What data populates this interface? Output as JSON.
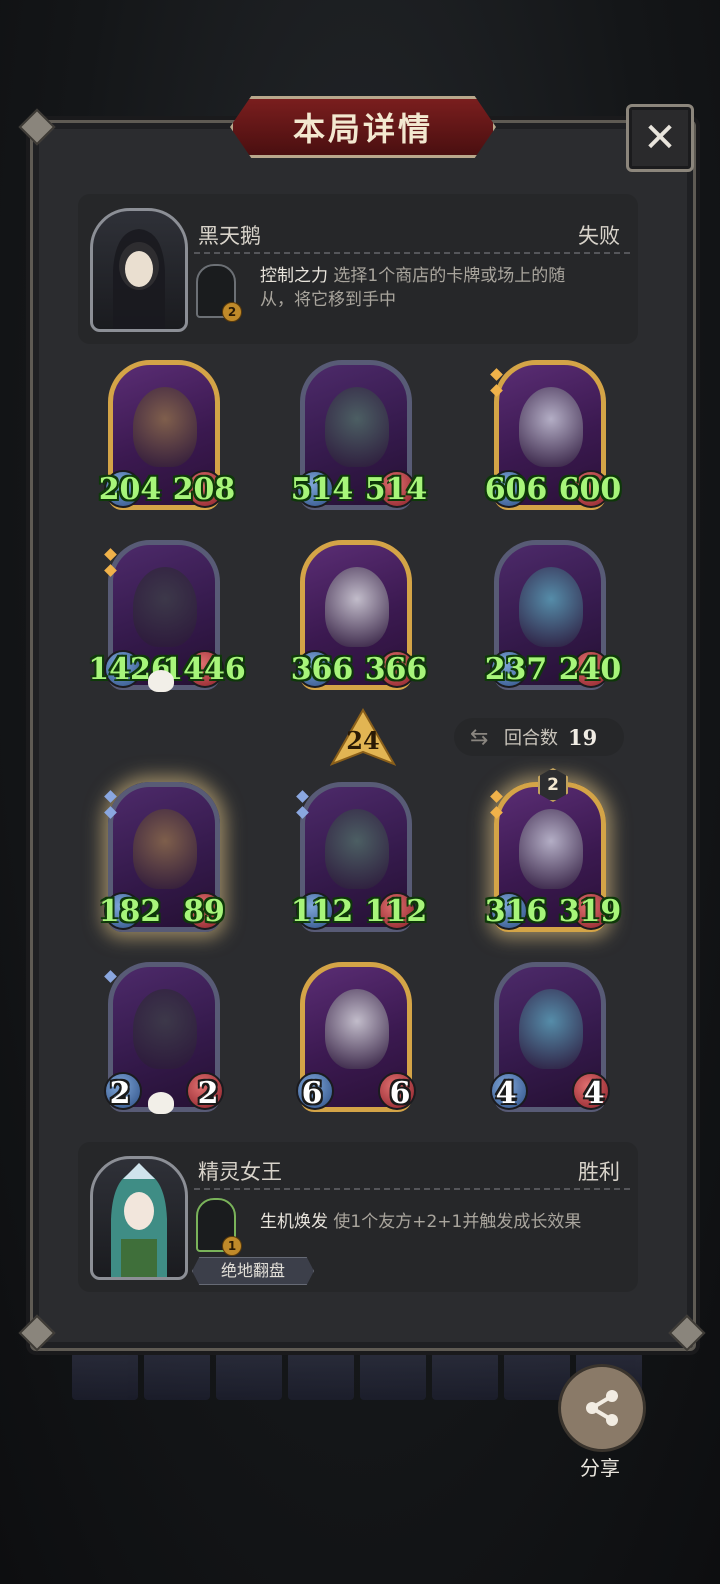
{
  "title": "本局详情",
  "close_symbol": "✕",
  "opponent": {
    "name": "黑天鹅",
    "result": "失败",
    "hero_power_level": "2",
    "ability_name": "控制之力",
    "ability_text_1": "选择1个商店的卡牌或场上的随",
    "ability_text_2": "从，将它移到手中"
  },
  "opponent_board": [
    {
      "attack": "204",
      "health": "208",
      "frame": "gold",
      "stars": 0,
      "star_color": ""
    },
    {
      "attack": "514",
      "health": "514",
      "frame": "purple",
      "stars": 0,
      "star_color": ""
    },
    {
      "attack": "606",
      "health": "600",
      "frame": "gold",
      "stars": 2,
      "star_color": "gold"
    },
    {
      "attack": "1426",
      "health": "1446",
      "frame": "purple",
      "stars": 2,
      "star_color": "gold"
    },
    {
      "attack": "366",
      "health": "366",
      "frame": "gold",
      "stars": 0,
      "star_color": ""
    },
    {
      "attack": "237",
      "health": "240",
      "frame": "purple",
      "stars": 0,
      "star_color": ""
    }
  ],
  "turn_arrow_value": "24",
  "round": {
    "icon": "swap-icon",
    "label": "回合数",
    "value": "19"
  },
  "player_board": [
    {
      "attack": "182",
      "health": "89",
      "frame": "purple",
      "stars": 2,
      "star_color": "blue",
      "glow": true
    },
    {
      "attack": "112",
      "health": "112",
      "frame": "purple",
      "stars": 2,
      "star_color": "blue"
    },
    {
      "attack": "316",
      "health": "319",
      "frame": "gold",
      "stars": 2,
      "star_color": "gold",
      "glow": true,
      "tier": "2"
    },
    {
      "attack": "2",
      "health": "2",
      "frame": "purple",
      "stars": 1,
      "star_color": "blue"
    },
    {
      "attack": "6",
      "health": "6",
      "frame": "gold",
      "stars": 0,
      "star_color": ""
    },
    {
      "attack": "4",
      "health": "4",
      "frame": "purple",
      "stars": 0,
      "star_color": ""
    }
  ],
  "player": {
    "name": "精灵女王",
    "result": "胜利",
    "hero_power_level": "1",
    "ability_name": "生机焕发",
    "ability_text": "使1个友方+2+1并触发成长效果",
    "tag": "绝地翻盘"
  },
  "share_label": "分享",
  "colors": {
    "stat_green": "#a7f57a",
    "gold_frame": "#d4a447",
    "banner_red": "#7a1e1e"
  }
}
